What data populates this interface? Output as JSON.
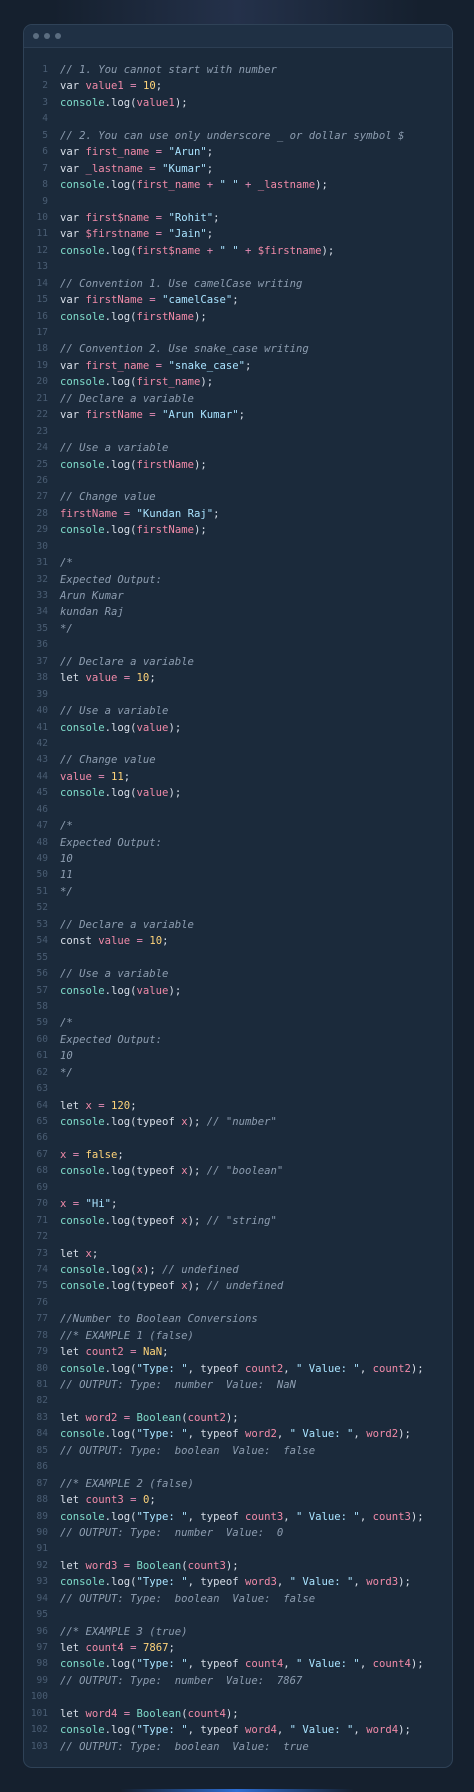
{
  "window": {
    "title": ""
  },
  "lines": [
    [
      [
        "c",
        "// 1. You cannot start with number"
      ]
    ],
    [
      [
        "k",
        "var "
      ],
      [
        "v",
        "value1"
      ],
      [
        "op",
        " = "
      ],
      [
        "n",
        "10"
      ],
      [
        "k",
        ";"
      ]
    ],
    [
      [
        "f",
        "console"
      ],
      [
        "k",
        ".log("
      ],
      [
        "v",
        "value1"
      ],
      [
        "k",
        ");"
      ]
    ],
    [],
    [
      [
        "c",
        "// 2. You can use only underscore _ or dollar symbol $"
      ]
    ],
    [
      [
        "k",
        "var "
      ],
      [
        "v",
        "first_name"
      ],
      [
        "op",
        " = "
      ],
      [
        "s",
        "\"Arun\""
      ],
      [
        "k",
        ";"
      ]
    ],
    [
      [
        "k",
        "var "
      ],
      [
        "v",
        "_lastname"
      ],
      [
        "op",
        " = "
      ],
      [
        "s",
        "\"Kumar\""
      ],
      [
        "k",
        ";"
      ]
    ],
    [
      [
        "f",
        "console"
      ],
      [
        "k",
        ".log("
      ],
      [
        "v",
        "first_name"
      ],
      [
        "op",
        " + "
      ],
      [
        "s",
        "\" \""
      ],
      [
        "op",
        " + "
      ],
      [
        "v",
        "_lastname"
      ],
      [
        "k",
        ");"
      ]
    ],
    [],
    [
      [
        "k",
        "var "
      ],
      [
        "v",
        "first$name"
      ],
      [
        "op",
        " = "
      ],
      [
        "s",
        "\"Rohit\""
      ],
      [
        "k",
        ";"
      ]
    ],
    [
      [
        "k",
        "var "
      ],
      [
        "v",
        "$firstname"
      ],
      [
        "op",
        " = "
      ],
      [
        "s",
        "\"Jain\""
      ],
      [
        "k",
        ";"
      ]
    ],
    [
      [
        "f",
        "console"
      ],
      [
        "k",
        ".log("
      ],
      [
        "v",
        "first$name"
      ],
      [
        "op",
        " + "
      ],
      [
        "s",
        "\" \""
      ],
      [
        "op",
        " + "
      ],
      [
        "v",
        "$firstname"
      ],
      [
        "k",
        ");"
      ]
    ],
    [],
    [
      [
        "c",
        "// Convention 1. Use camelCase writing"
      ]
    ],
    [
      [
        "k",
        "var "
      ],
      [
        "v",
        "firstName"
      ],
      [
        "op",
        " = "
      ],
      [
        "s",
        "\"camelCase\""
      ],
      [
        "k",
        ";"
      ]
    ],
    [
      [
        "f",
        "console"
      ],
      [
        "k",
        ".log("
      ],
      [
        "v",
        "firstName"
      ],
      [
        "k",
        ");"
      ]
    ],
    [],
    [
      [
        "c",
        "// Convention 2. Use snake_case writing"
      ]
    ],
    [
      [
        "k",
        "var "
      ],
      [
        "v",
        "first_name"
      ],
      [
        "op",
        " = "
      ],
      [
        "s",
        "\"snake_case\""
      ],
      [
        "k",
        ";"
      ]
    ],
    [
      [
        "f",
        "console"
      ],
      [
        "k",
        ".log("
      ],
      [
        "v",
        "first_name"
      ],
      [
        "k",
        ");"
      ]
    ],
    [
      [
        "c",
        "// Declare a variable"
      ]
    ],
    [
      [
        "k",
        "var "
      ],
      [
        "v",
        "firstName"
      ],
      [
        "op",
        " = "
      ],
      [
        "s",
        "\"Arun Kumar\""
      ],
      [
        "k",
        ";"
      ]
    ],
    [],
    [
      [
        "c",
        "// Use a variable"
      ]
    ],
    [
      [
        "f",
        "console"
      ],
      [
        "k",
        ".log("
      ],
      [
        "v",
        "firstName"
      ],
      [
        "k",
        ");"
      ]
    ],
    [],
    [
      [
        "c",
        "// Change value"
      ]
    ],
    [
      [
        "v",
        "firstName"
      ],
      [
        "op",
        " = "
      ],
      [
        "s",
        "\"Kundan Raj\""
      ],
      [
        "k",
        ";"
      ]
    ],
    [
      [
        "f",
        "console"
      ],
      [
        "k",
        ".log("
      ],
      [
        "v",
        "firstName"
      ],
      [
        "k",
        ");"
      ]
    ],
    [],
    [
      [
        "c",
        "/*"
      ]
    ],
    [
      [
        "c",
        "Expected Output:"
      ]
    ],
    [
      [
        "c",
        "Arun Kumar"
      ]
    ],
    [
      [
        "c",
        "kundan Raj"
      ]
    ],
    [
      [
        "c",
        "*/"
      ]
    ],
    [],
    [
      [
        "c",
        "// Declare a variable"
      ]
    ],
    [
      [
        "k",
        "let "
      ],
      [
        "v",
        "value"
      ],
      [
        "op",
        " = "
      ],
      [
        "n",
        "10"
      ],
      [
        "k",
        ";"
      ]
    ],
    [],
    [
      [
        "c",
        "// Use a variable"
      ]
    ],
    [
      [
        "f",
        "console"
      ],
      [
        "k",
        ".log("
      ],
      [
        "v",
        "value"
      ],
      [
        "k",
        ");"
      ]
    ],
    [],
    [
      [
        "c",
        "// Change value"
      ]
    ],
    [
      [
        "v",
        "value"
      ],
      [
        "op",
        " = "
      ],
      [
        "n",
        "11"
      ],
      [
        "k",
        ";"
      ]
    ],
    [
      [
        "f",
        "console"
      ],
      [
        "k",
        ".log("
      ],
      [
        "v",
        "value"
      ],
      [
        "k",
        ");"
      ]
    ],
    [],
    [
      [
        "c",
        "/*"
      ]
    ],
    [
      [
        "c",
        "Expected Output:"
      ]
    ],
    [
      [
        "c",
        "10"
      ]
    ],
    [
      [
        "c",
        "11"
      ]
    ],
    [
      [
        "c",
        "*/"
      ]
    ],
    [],
    [
      [
        "c",
        "// Declare a variable"
      ]
    ],
    [
      [
        "k",
        "const "
      ],
      [
        "v",
        "value"
      ],
      [
        "op",
        " = "
      ],
      [
        "n",
        "10"
      ],
      [
        "k",
        ";"
      ]
    ],
    [],
    [
      [
        "c",
        "// Use a variable"
      ]
    ],
    [
      [
        "f",
        "console"
      ],
      [
        "k",
        ".log("
      ],
      [
        "v",
        "value"
      ],
      [
        "k",
        ");"
      ]
    ],
    [],
    [
      [
        "c",
        "/*"
      ]
    ],
    [
      [
        "c",
        "Expected Output:"
      ]
    ],
    [
      [
        "c",
        "10"
      ]
    ],
    [
      [
        "c",
        "*/"
      ]
    ],
    [],
    [
      [
        "k",
        "let "
      ],
      [
        "v",
        "x"
      ],
      [
        "op",
        " = "
      ],
      [
        "n",
        "120"
      ],
      [
        "k",
        ";"
      ]
    ],
    [
      [
        "f",
        "console"
      ],
      [
        "k",
        ".log(typeof "
      ],
      [
        "v",
        "x"
      ],
      [
        "k",
        "); "
      ],
      [
        "c",
        "// \"number\""
      ]
    ],
    [],
    [
      [
        "v",
        "x"
      ],
      [
        "op",
        " = "
      ],
      [
        "n",
        "false"
      ],
      [
        "k",
        ";"
      ]
    ],
    [
      [
        "f",
        "console"
      ],
      [
        "k",
        ".log(typeof "
      ],
      [
        "v",
        "x"
      ],
      [
        "k",
        "); "
      ],
      [
        "c",
        "// \"boolean\""
      ]
    ],
    [],
    [
      [
        "v",
        "x"
      ],
      [
        "op",
        " = "
      ],
      [
        "s",
        "\"Hi\""
      ],
      [
        "k",
        ";"
      ]
    ],
    [
      [
        "f",
        "console"
      ],
      [
        "k",
        ".log(typeof "
      ],
      [
        "v",
        "x"
      ],
      [
        "k",
        "); "
      ],
      [
        "c",
        "// \"string\""
      ]
    ],
    [],
    [
      [
        "k",
        "let "
      ],
      [
        "v",
        "x"
      ],
      [
        "k",
        ";"
      ]
    ],
    [
      [
        "f",
        "console"
      ],
      [
        "k",
        ".log("
      ],
      [
        "v",
        "x"
      ],
      [
        "k",
        "); "
      ],
      [
        "c",
        "// undefined"
      ]
    ],
    [
      [
        "f",
        "console"
      ],
      [
        "k",
        ".log(typeof "
      ],
      [
        "v",
        "x"
      ],
      [
        "k",
        "); "
      ],
      [
        "c",
        "// undefined"
      ]
    ],
    [],
    [
      [
        "c",
        "//Number to Boolean Conversions"
      ]
    ],
    [
      [
        "c",
        "//* EXAMPLE 1 (false)"
      ]
    ],
    [
      [
        "k",
        "let "
      ],
      [
        "v",
        "count2"
      ],
      [
        "op",
        " = "
      ],
      [
        "n",
        "NaN"
      ],
      [
        "k",
        ";"
      ]
    ],
    [
      [
        "f",
        "console"
      ],
      [
        "k",
        ".log("
      ],
      [
        "s",
        "\"Type: \""
      ],
      [
        "k",
        ", typeof "
      ],
      [
        "v",
        "count2"
      ],
      [
        "k",
        ", "
      ],
      [
        "s",
        "\" Value: \""
      ],
      [
        "k",
        ", "
      ],
      [
        "v",
        "count2"
      ],
      [
        "k",
        ");"
      ]
    ],
    [
      [
        "c",
        "// OUTPUT: Type:  number  Value:  NaN"
      ]
    ],
    [],
    [
      [
        "k",
        "let "
      ],
      [
        "v",
        "word2"
      ],
      [
        "op",
        " = "
      ],
      [
        "f",
        "Boolean"
      ],
      [
        "k",
        "("
      ],
      [
        "v",
        "count2"
      ],
      [
        "k",
        ");"
      ]
    ],
    [
      [
        "f",
        "console"
      ],
      [
        "k",
        ".log("
      ],
      [
        "s",
        "\"Type: \""
      ],
      [
        "k",
        ", typeof "
      ],
      [
        "v",
        "word2"
      ],
      [
        "k",
        ", "
      ],
      [
        "s",
        "\" Value: \""
      ],
      [
        "k",
        ", "
      ],
      [
        "v",
        "word2"
      ],
      [
        "k",
        ");"
      ]
    ],
    [
      [
        "c",
        "// OUTPUT: Type:  boolean  Value:  false"
      ]
    ],
    [],
    [
      [
        "c",
        "//* EXAMPLE 2 (false)"
      ]
    ],
    [
      [
        "k",
        "let "
      ],
      [
        "v",
        "count3"
      ],
      [
        "op",
        " = "
      ],
      [
        "n",
        "0"
      ],
      [
        "k",
        ";"
      ]
    ],
    [
      [
        "f",
        "console"
      ],
      [
        "k",
        ".log("
      ],
      [
        "s",
        "\"Type: \""
      ],
      [
        "k",
        ", typeof "
      ],
      [
        "v",
        "count3"
      ],
      [
        "k",
        ", "
      ],
      [
        "s",
        "\" Value: \""
      ],
      [
        "k",
        ", "
      ],
      [
        "v",
        "count3"
      ],
      [
        "k",
        ");"
      ]
    ],
    [
      [
        "c",
        "// OUTPUT: Type:  number  Value:  0"
      ]
    ],
    [],
    [
      [
        "k",
        "let "
      ],
      [
        "v",
        "word3"
      ],
      [
        "op",
        " = "
      ],
      [
        "f",
        "Boolean"
      ],
      [
        "k",
        "("
      ],
      [
        "v",
        "count3"
      ],
      [
        "k",
        ");"
      ]
    ],
    [
      [
        "f",
        "console"
      ],
      [
        "k",
        ".log("
      ],
      [
        "s",
        "\"Type: \""
      ],
      [
        "k",
        ", typeof "
      ],
      [
        "v",
        "word3"
      ],
      [
        "k",
        ", "
      ],
      [
        "s",
        "\" Value: \""
      ],
      [
        "k",
        ", "
      ],
      [
        "v",
        "word3"
      ],
      [
        "k",
        ");"
      ]
    ],
    [
      [
        "c",
        "// OUTPUT: Type:  boolean  Value:  false"
      ]
    ],
    [],
    [
      [
        "c",
        "//* EXAMPLE 3 (true)"
      ]
    ],
    [
      [
        "k",
        "let "
      ],
      [
        "v",
        "count4"
      ],
      [
        "op",
        " = "
      ],
      [
        "n",
        "7867"
      ],
      [
        "k",
        ";"
      ]
    ],
    [
      [
        "f",
        "console"
      ],
      [
        "k",
        ".log("
      ],
      [
        "s",
        "\"Type: \""
      ],
      [
        "k",
        ", typeof "
      ],
      [
        "v",
        "count4"
      ],
      [
        "k",
        ", "
      ],
      [
        "s",
        "\" Value: \""
      ],
      [
        "k",
        ", "
      ],
      [
        "v",
        "count4"
      ],
      [
        "k",
        ");"
      ]
    ],
    [
      [
        "c",
        "// OUTPUT: Type:  number  Value:  7867"
      ]
    ],
    [],
    [
      [
        "k",
        "let "
      ],
      [
        "v",
        "word4"
      ],
      [
        "op",
        " = "
      ],
      [
        "f",
        "Boolean"
      ],
      [
        "k",
        "("
      ],
      [
        "v",
        "count4"
      ],
      [
        "k",
        ");"
      ]
    ],
    [
      [
        "f",
        "console"
      ],
      [
        "k",
        ".log("
      ],
      [
        "s",
        "\"Type: \""
      ],
      [
        "k",
        ", typeof "
      ],
      [
        "v",
        "word4"
      ],
      [
        "k",
        ", "
      ],
      [
        "s",
        "\" Value: \""
      ],
      [
        "k",
        ", "
      ],
      [
        "v",
        "word4"
      ],
      [
        "k",
        ");"
      ]
    ],
    [
      [
        "c",
        "// OUTPUT: Type:  boolean  Value:  true"
      ]
    ]
  ],
  "colors": {
    "background": "#15202e",
    "editor": "#1b2a3b",
    "comment": "#8d9db0",
    "variable": "#f08aa8",
    "string": "#a9e3ff",
    "number": "#ffd47a",
    "function": "#7fdbca"
  }
}
